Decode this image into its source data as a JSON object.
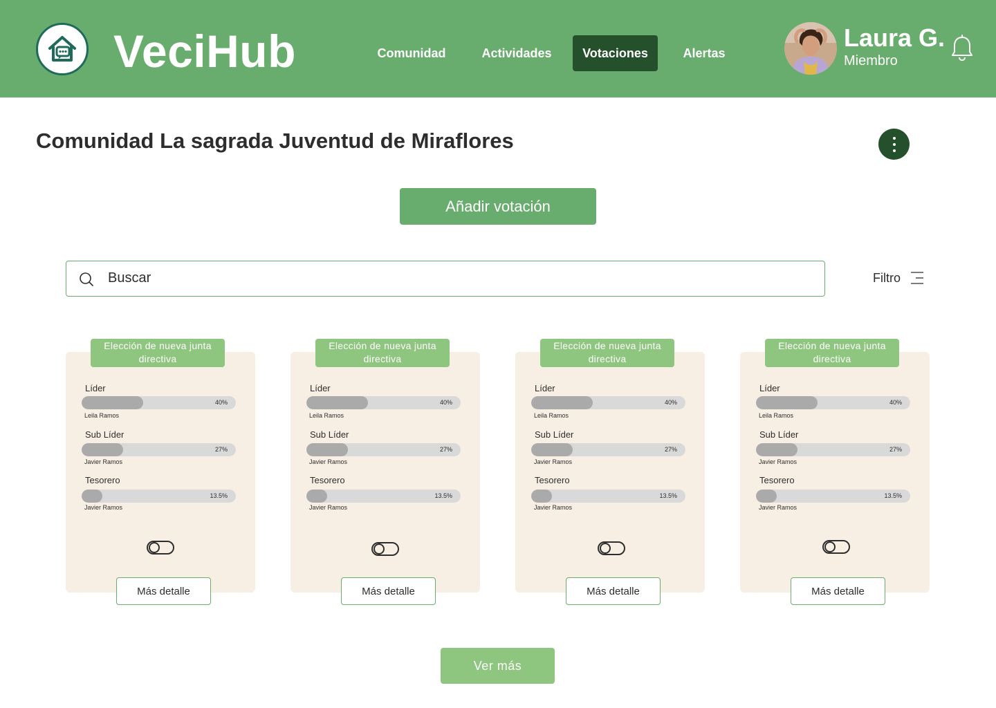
{
  "header": {
    "brand": "VeciHub",
    "nav": [
      {
        "label": "Comunidad",
        "active": false
      },
      {
        "label": "Actividades",
        "active": false
      },
      {
        "label": "Votaciones",
        "active": true
      },
      {
        "label": "Alertas",
        "active": false
      }
    ],
    "user": {
      "name": "Laura G.",
      "role": "Miembro"
    },
    "icons": {
      "logo": "house-chat-logo-icon",
      "notifications": "bell-icon"
    }
  },
  "page": {
    "title": "Comunidad La sagrada Juventud de Miraflores",
    "menu_icon": "kebab-menu-icon",
    "add_button": "Añadir votación",
    "search": {
      "placeholder": "Buscar",
      "value": ""
    },
    "filter_label": "Filtro",
    "more_button": "Ver más"
  },
  "cards": [
    {
      "title": "Elección de nueva junta directiva",
      "positions": [
        {
          "label": "Líder",
          "percent_label": "40%",
          "percent": 40,
          "candidate": "Leila Ramos"
        },
        {
          "label": "Sub Líder",
          "percent_label": "27%",
          "percent": 27,
          "candidate": "Javier Ramos"
        },
        {
          "label": "Tesorero",
          "percent_label": "13.5%",
          "percent": 13.5,
          "candidate": "Javier Ramos"
        }
      ],
      "toggle_on": false,
      "detail_button": "Más detalle"
    },
    {
      "title": "Elección de nueva junta directiva",
      "positions": [
        {
          "label": "Líder",
          "percent_label": "40%",
          "percent": 40,
          "candidate": "Leila Ramos"
        },
        {
          "label": "Sub Líder",
          "percent_label": "27%",
          "percent": 27,
          "candidate": "Javier Ramos"
        },
        {
          "label": "Tesorero",
          "percent_label": "13.5%",
          "percent": 13.5,
          "candidate": "Javier Ramos"
        }
      ],
      "toggle_on": false,
      "detail_button": "Más detalle"
    },
    {
      "title": "Elección de nueva junta directiva",
      "positions": [
        {
          "label": "Líder",
          "percent_label": "40%",
          "percent": 40,
          "candidate": "Leila Ramos"
        },
        {
          "label": "Sub Líder",
          "percent_label": "27%",
          "percent": 27,
          "candidate": "Javier Ramos"
        },
        {
          "label": "Tesorero",
          "percent_label": "13.5%",
          "percent": 13.5,
          "candidate": "Javier Ramos"
        }
      ],
      "toggle_on": false,
      "detail_button": "Más detalle"
    },
    {
      "title": "Elección de nueva junta directiva",
      "positions": [
        {
          "label": "Líder",
          "percent_label": "40%",
          "percent": 40,
          "candidate": "Leila Ramos"
        },
        {
          "label": "Sub Líder",
          "percent_label": "27%",
          "percent": 27,
          "candidate": "Javier Ramos"
        },
        {
          "label": "Tesorero",
          "percent_label": "13.5%",
          "percent": 13.5,
          "candidate": "Javier Ramos"
        }
      ],
      "toggle_on": false,
      "detail_button": "Más detalle"
    }
  ],
  "colors": {
    "header_bg": "#68ad6d",
    "nav_active": "#24512b",
    "card_bg": "#f8efe4",
    "tag_bg": "#8fc67f",
    "bar_track": "#d9d9d9",
    "bar_fill": "#aaaaaa"
  }
}
